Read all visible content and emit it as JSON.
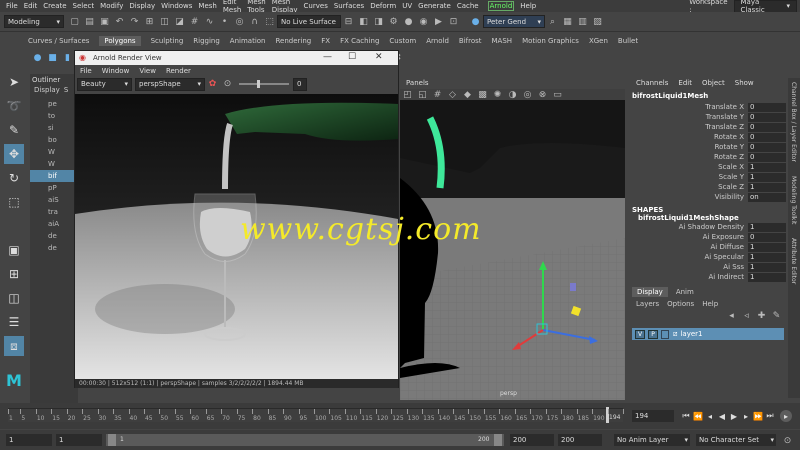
{
  "menubar": {
    "items": [
      "File",
      "Edit",
      "Create",
      "Select",
      "Modify",
      "Display",
      "Windows",
      "Mesh",
      "Edit Mesh",
      "Mesh Tools",
      "Mesh Display",
      "Curves",
      "Surfaces",
      "Deform",
      "UV",
      "Generate",
      "Cache"
    ],
    "arnold": "Arnold",
    "help": "Help",
    "workspace_label": "Workspace :",
    "workspace_value": "Maya Classic"
  },
  "statusline": {
    "mode": "Modeling",
    "live_surface": "No Live Surface",
    "user": "Peter Gend"
  },
  "shelf": {
    "tabs": [
      "Curves / Surfaces",
      "Polygons",
      "Sculpting",
      "Rigging",
      "Animation",
      "Rendering",
      "FX",
      "FX Caching",
      "Custom",
      "Arnold",
      "Bifrost",
      "MASH",
      "Motion Graphics",
      "XGen",
      "Bullet"
    ],
    "active": "Polygons"
  },
  "outliner": {
    "title": "Outliner",
    "menus": [
      "Display",
      "S"
    ],
    "items": [
      "pe",
      "to",
      "si",
      "bo",
      "W",
      "W",
      "bif",
      "pP",
      "aiS",
      "tra",
      "aiA",
      "de",
      "de"
    ]
  },
  "renderview": {
    "title": "Arnold Render View",
    "menus": [
      "File",
      "Window",
      "View",
      "Render"
    ],
    "aov": "Beauty",
    "camera": "perspShape",
    "exposure": "0",
    "status": "00:00:30 | 512x512 (1:1) | perspShape | samples 3/2/2/2/2/2 | 1894.44 MB"
  },
  "viewport": {
    "panels_menu": "Panels",
    "camera_label": "persp"
  },
  "channelbox": {
    "menus": [
      "Channels",
      "Edit",
      "Object",
      "Show"
    ],
    "object": "bifrostLiquid1Mesh",
    "attrs": [
      {
        "name": "Translate X",
        "value": "0"
      },
      {
        "name": "Translate Y",
        "value": "0"
      },
      {
        "name": "Translate Z",
        "value": "0"
      },
      {
        "name": "Rotate X",
        "value": "0"
      },
      {
        "name": "Rotate Y",
        "value": "0"
      },
      {
        "name": "Rotate Z",
        "value": "0"
      },
      {
        "name": "Scale X",
        "value": "1"
      },
      {
        "name": "Scale Y",
        "value": "1"
      },
      {
        "name": "Scale Z",
        "value": "1"
      },
      {
        "name": "Visibility",
        "value": "on"
      }
    ],
    "shapes_header": "SHAPES",
    "shape_name": "bifrostLiquid1MeshShape",
    "shape_attrs": [
      {
        "name": "Ai Shadow Density",
        "value": "1"
      },
      {
        "name": "Ai Exposure",
        "value": "0"
      },
      {
        "name": "Ai Diffuse",
        "value": "1"
      },
      {
        "name": "Ai Specular",
        "value": "1"
      },
      {
        "name": "Ai Sss",
        "value": "1"
      },
      {
        "name": "Ai Indirect",
        "value": "1"
      }
    ]
  },
  "layers": {
    "tabs": [
      "Display",
      "Anim"
    ],
    "menus": [
      "Layers",
      "Options",
      "Help"
    ],
    "layer_v": "V",
    "layer_p": "P",
    "layer_name": "layer1"
  },
  "sidetabs": [
    "Channel Box / Layer Editor",
    "Modeling Toolkit",
    "Attribute Editor"
  ],
  "timeline": {
    "labels": [
      "1",
      "5",
      "10",
      "15",
      "20",
      "25",
      "30",
      "35",
      "40",
      "45",
      "50",
      "55",
      "60",
      "65",
      "70",
      "75",
      "80",
      "85",
      "90",
      "95",
      "100",
      "105",
      "110",
      "115",
      "120",
      "125",
      "130",
      "135",
      "140",
      "145",
      "150",
      "155",
      "160",
      "165",
      "170",
      "175",
      "180",
      "185",
      "190"
    ],
    "marker": "194",
    "current_frame": "194"
  },
  "range": {
    "start": "1",
    "playback_start": "1",
    "slider_start": "1",
    "slider_end": "200",
    "playback_end": "200",
    "end": "200",
    "anim_layer": "No Anim Layer",
    "char_set": "No Character Set"
  },
  "watermark": "www.cgtsj.com"
}
